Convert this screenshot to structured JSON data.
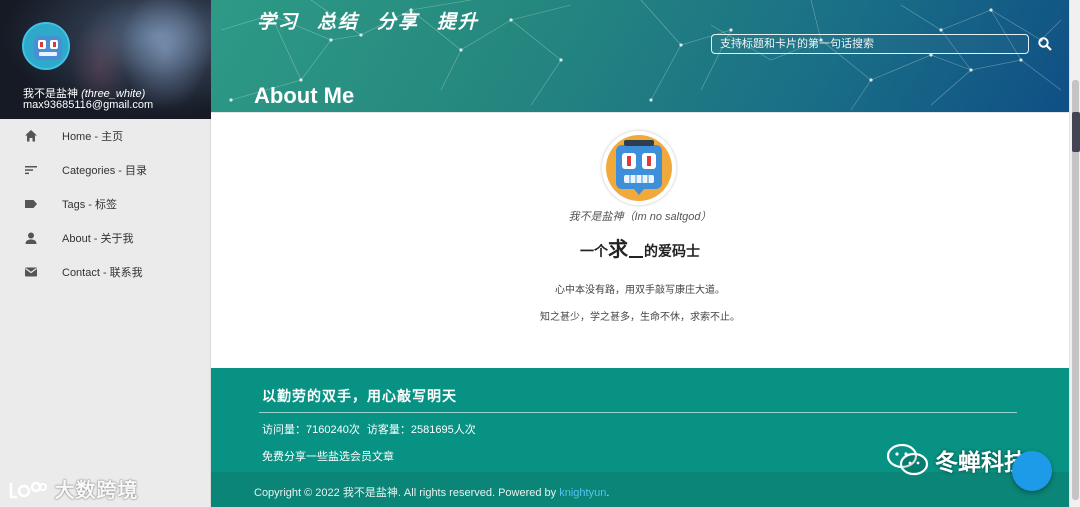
{
  "profile": {
    "name": "我不是盐神",
    "name_alias": "(three_white)",
    "email": "max93685116@gmail.com"
  },
  "nav": {
    "items": [
      {
        "label": "Home - 主页",
        "icon": "home-icon"
      },
      {
        "label": "Categories - 目录",
        "icon": "sort-icon"
      },
      {
        "label": "Tags - 标签",
        "icon": "label-icon"
      },
      {
        "label": "About - 关于我",
        "icon": "person-icon"
      },
      {
        "label": "Contact - 联系我",
        "icon": "mail-icon"
      }
    ]
  },
  "header": {
    "slogan": [
      "学习",
      "总结",
      "分享",
      "提升"
    ],
    "search_placeholder": "支持标题和卡片的第一句话搜索",
    "page_title": "About Me"
  },
  "about": {
    "name_line": "我不是盐神（Im no saltgod）",
    "motto_prefix": "一个",
    "motto_big": "求",
    "motto_suffix": "的爱码士",
    "line1": "心中本没有路，用双手敲写康庄大道。",
    "line2": "知之甚少，学之甚多，生命不休，求索不止。"
  },
  "footer": {
    "slogan": "以勤劳的双手，用心敲写明天",
    "visits": "访问量：7160240次",
    "visitors": "访客量：2581695人次",
    "share": "免费分享一些盐选会员文章",
    "copyright_prefix": "Copyright © 2022 我不是盐神. All rights reserved. Powered by ",
    "powered_link": "knightyun",
    "copyright_suffix": "."
  },
  "watermarks": {
    "left": "大数跨境",
    "right": "冬蝉科技"
  },
  "colors": {
    "footer": "#079283",
    "header_start": "#2e9a86",
    "header_end": "#0f4f85",
    "link": "#56c2f0",
    "fab": "#1e9be8"
  }
}
